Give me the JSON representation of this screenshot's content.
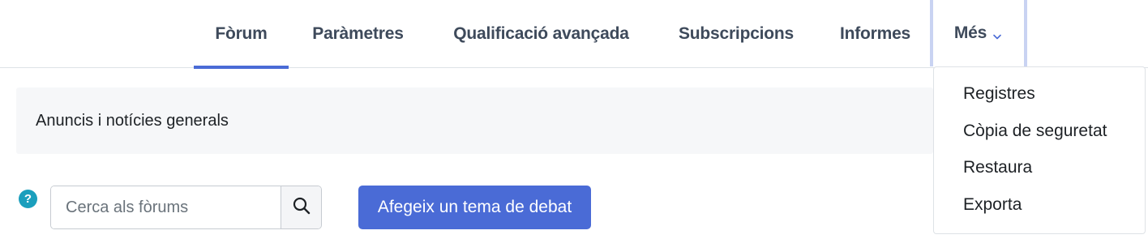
{
  "nav": {
    "tabs": [
      {
        "label": "Fòrum",
        "active": true
      },
      {
        "label": "Paràmetres",
        "active": false
      },
      {
        "label": "Qualificació avançada",
        "active": false
      },
      {
        "label": "Subscripcions",
        "active": false
      },
      {
        "label": "Informes",
        "active": false
      },
      {
        "label": "Més",
        "active": false,
        "expanded": true
      }
    ],
    "more_icon": "chevron-down-icon"
  },
  "dropdown": {
    "items": [
      "Registres",
      "Còpia de seguretat",
      "Restaura",
      "Exporta"
    ]
  },
  "info": {
    "text": "Anuncis i notícies generals"
  },
  "help": {
    "glyph": "?",
    "icon": "question-circle-icon",
    "color": "#1b9fbd"
  },
  "search": {
    "value": "",
    "placeholder": "Cerca als fòrums",
    "icon": "search-icon"
  },
  "actions": {
    "add_topic_label": "Afegeix un tema de debat"
  },
  "colors": {
    "accent": "#4a6bd6",
    "text": "#3e4a5b"
  }
}
